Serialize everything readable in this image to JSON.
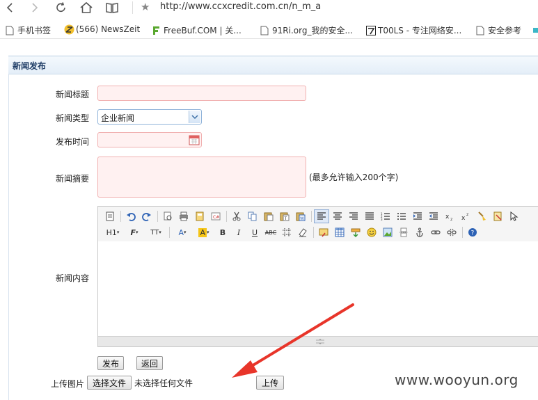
{
  "browser": {
    "url": "http://www.ccxcredit.com.cn/n_m_a",
    "bookmarks": [
      {
        "label": "手机书签",
        "icon": "page-icon"
      },
      {
        "label": "(566) NewsZeit",
        "icon": "newszeit-icon"
      },
      {
        "label": "FreeBuf.COM | 关...",
        "icon": "freebuf-icon"
      },
      {
        "label": "91Ri.org_我的安全...",
        "icon": "page-icon"
      },
      {
        "label": "T00LS - 专注网络安...",
        "icon": "t00ls-icon"
      },
      {
        "label": "安全参考",
        "icon": "page-icon"
      }
    ]
  },
  "form": {
    "panel_title": "新闻发布",
    "title_label": "新闻标题",
    "title_value": "",
    "type_label": "新闻类型",
    "type_value": "企业新闻",
    "time_label": "发布时间",
    "time_value": "",
    "summary_label": "新闻摘要",
    "summary_hint": "(最多允许输入200个字)",
    "content_label": "新闻内容",
    "publish_button": "发布",
    "back_button": "返回",
    "upload_label": "上传图片",
    "choose_file_button": "选择文件",
    "no_file_text": "未选择任何文件",
    "upload_button": "上传"
  },
  "editor_toolbar": {
    "row2_text": {
      "heading": "H1",
      "font_family": "F",
      "font_size": "TT",
      "font_color": "A",
      "highlight": "A",
      "bold": "B",
      "italic": "I",
      "underline": "U",
      "strike": "ABC"
    }
  },
  "watermark": "www.wooyun.org",
  "colors": {
    "required_field_bg": "#fff1f1",
    "required_field_border": "#f1b0b0",
    "panel_title": "#1f3d66",
    "arrow_red": "#e8352a"
  }
}
